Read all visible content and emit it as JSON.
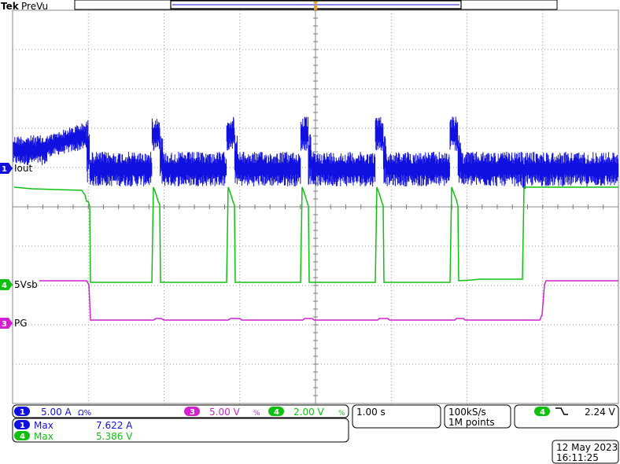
{
  "header": {
    "brand": "Tek",
    "mode": "PreVu"
  },
  "channels": {
    "ch1": {
      "number": "1",
      "label": "Iout",
      "scale": "5.00 A",
      "coupling_icon": "Ω%",
      "color": "#1010e0"
    },
    "ch3": {
      "number": "3",
      "label": "PG",
      "scale": "5.00 V",
      "coupling_icon": "%",
      "color": "#d020d0"
    },
    "ch4": {
      "number": "4",
      "label": "5Vsb",
      "scale": "2.00 V",
      "coupling_icon": "%",
      "color": "#10c010"
    }
  },
  "measurements": [
    {
      "channel": "1",
      "type": "Max",
      "value": "7.622 A"
    },
    {
      "channel": "4",
      "type": "Max",
      "value": "5.386 V"
    }
  ],
  "timebase": "1.00 s",
  "acquisition": {
    "sample_rate": "100kS/s",
    "record_length": "1M points"
  },
  "trigger": {
    "channel": "4",
    "slope_icon": "falling-edge",
    "level": "2.24 V"
  },
  "datetime": {
    "date": "12 May 2023",
    "time": "16:11:25"
  },
  "colors": {
    "ch1": "#1010e0",
    "ch3": "#d020d0",
    "ch4": "#10c010",
    "grid": "#9a9a9a"
  }
}
